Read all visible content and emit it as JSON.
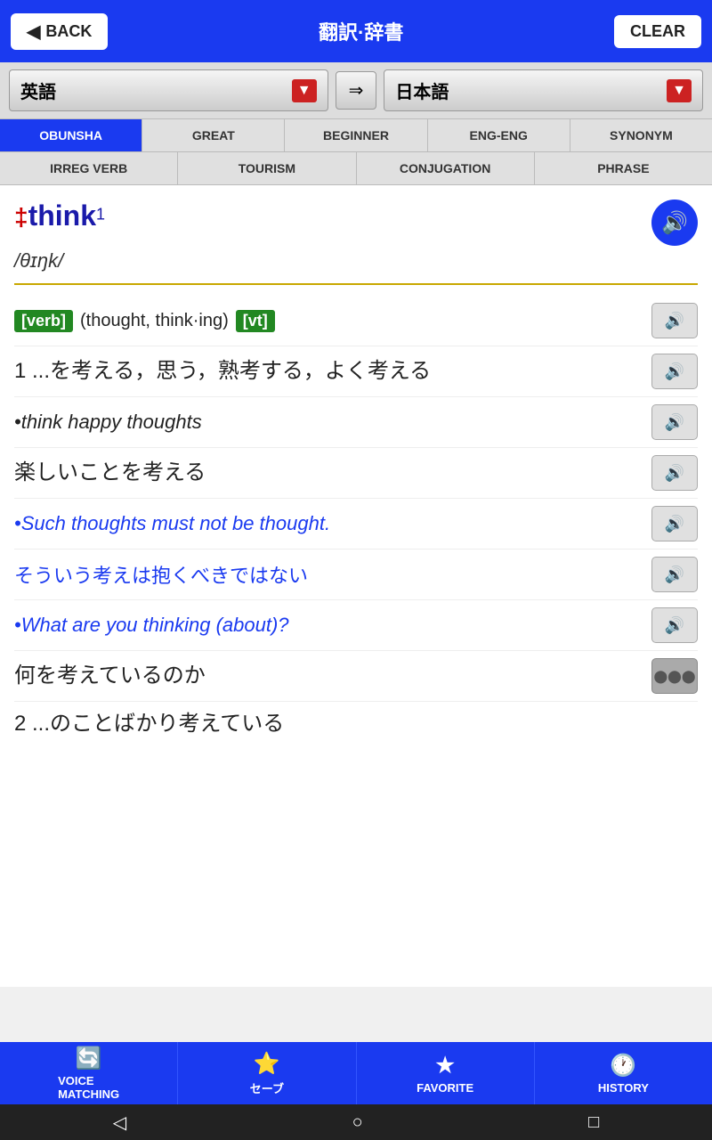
{
  "header": {
    "back_label": "BACK",
    "title": "翻訳·辞書",
    "clear_label": "CLEAR"
  },
  "lang_selector": {
    "source_lang": "英語",
    "target_lang": "日本語",
    "swap_icon": "⇔"
  },
  "tabs_row1": [
    {
      "label": "OBUNSHA",
      "active": true
    },
    {
      "label": "GREAT",
      "active": false
    },
    {
      "label": "BEGINNER",
      "active": false
    },
    {
      "label": "ENG-ENG",
      "active": false
    },
    {
      "label": "SYNONYM",
      "active": false
    }
  ],
  "tabs_row2": [
    {
      "label": "IRREG VERB",
      "active": false
    },
    {
      "label": "TOURISM",
      "active": false
    },
    {
      "label": "CONJUGATION",
      "active": false
    },
    {
      "label": "PHRASE",
      "active": false
    }
  ],
  "entry": {
    "word": "think",
    "superscript": "1",
    "marker": "‡",
    "pronunciation": "/θɪŋk/",
    "verb_tag": "[verb]",
    "verb_forms": "(thought, think·ing)",
    "vt_tag": "[vt]",
    "definition1": "1 ...を考える，思う，熟考する，よく考える",
    "example1_en": "•think happy thoughts",
    "example1_jp": "楽しいことを考える",
    "example2_en": "•Such thoughts must not be thought.",
    "example2_jp": "そういう考えは抱くべきではない",
    "example3_en": "•What are you thinking (about)?",
    "example3_jp": "何を考えているのか",
    "definition2_start": "2 ...のことばかり考えている"
  },
  "toolbar": {
    "buttons": [
      {
        "icon": "🔄",
        "label": "VOICE\nMATCHING"
      },
      {
        "icon": "⭐",
        "label": "セーブ"
      },
      {
        "icon": "★",
        "label": "FAVORITE"
      },
      {
        "icon": "🕐",
        "label": "HISTORY"
      }
    ]
  },
  "nav": {
    "back_icon": "◁",
    "home_icon": "○",
    "square_icon": "□"
  }
}
